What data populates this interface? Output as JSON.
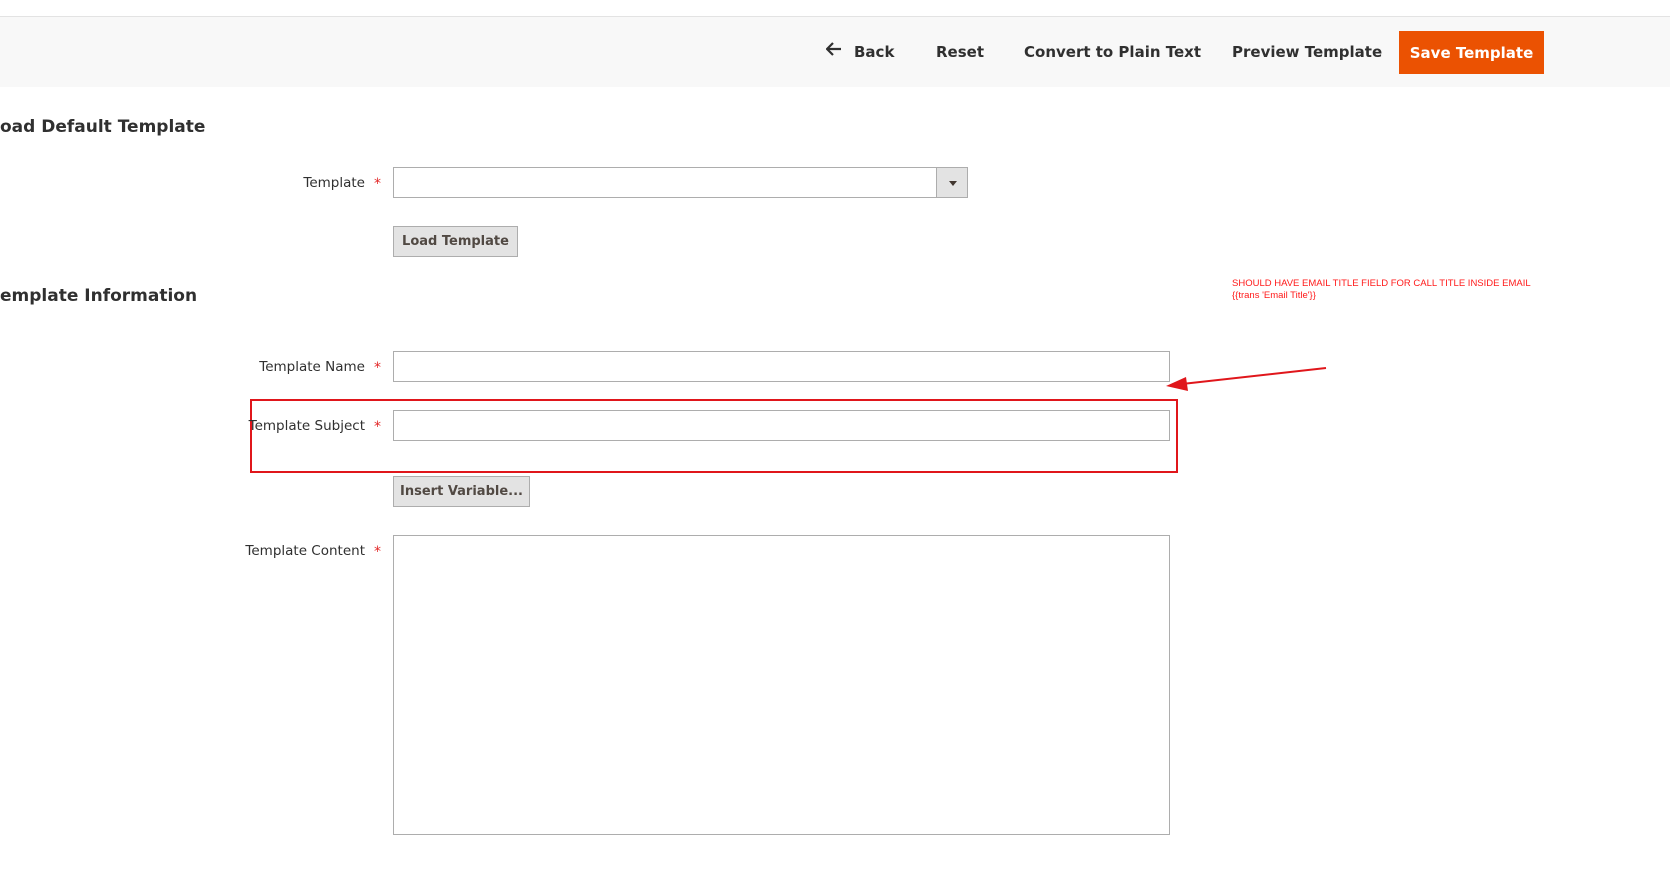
{
  "toolbar": {
    "back_label": "Back",
    "reset_label": "Reset",
    "plain_text_label": "Convert to Plain Text",
    "preview_label": "Preview Template",
    "save_label": "Save Template"
  },
  "load_default": {
    "title": "oad Default Template",
    "template_label": "Template",
    "template_value": "",
    "load_button_label": "Load Template"
  },
  "template_info": {
    "title": "emplate Information",
    "name_label": "Template Name",
    "name_value": "",
    "subject_label": "Template Subject",
    "subject_value": "",
    "insert_variable_label": "Insert Variable...",
    "content_label": "Template Content",
    "content_value": ""
  },
  "required_marker": "*",
  "annotation": {
    "line1": "SHOULD HAVE EMAIL TITLE FIELD FOR CALL TITLE INSIDE EMAIL",
    "line2": "{{trans 'Email Title'}}"
  },
  "colors": {
    "primary": "#eb5202",
    "annotation": "#e0161b",
    "required": "#e22626"
  },
  "icons": {
    "back": "left-arrow-icon",
    "select": "chevron-down-icon"
  }
}
